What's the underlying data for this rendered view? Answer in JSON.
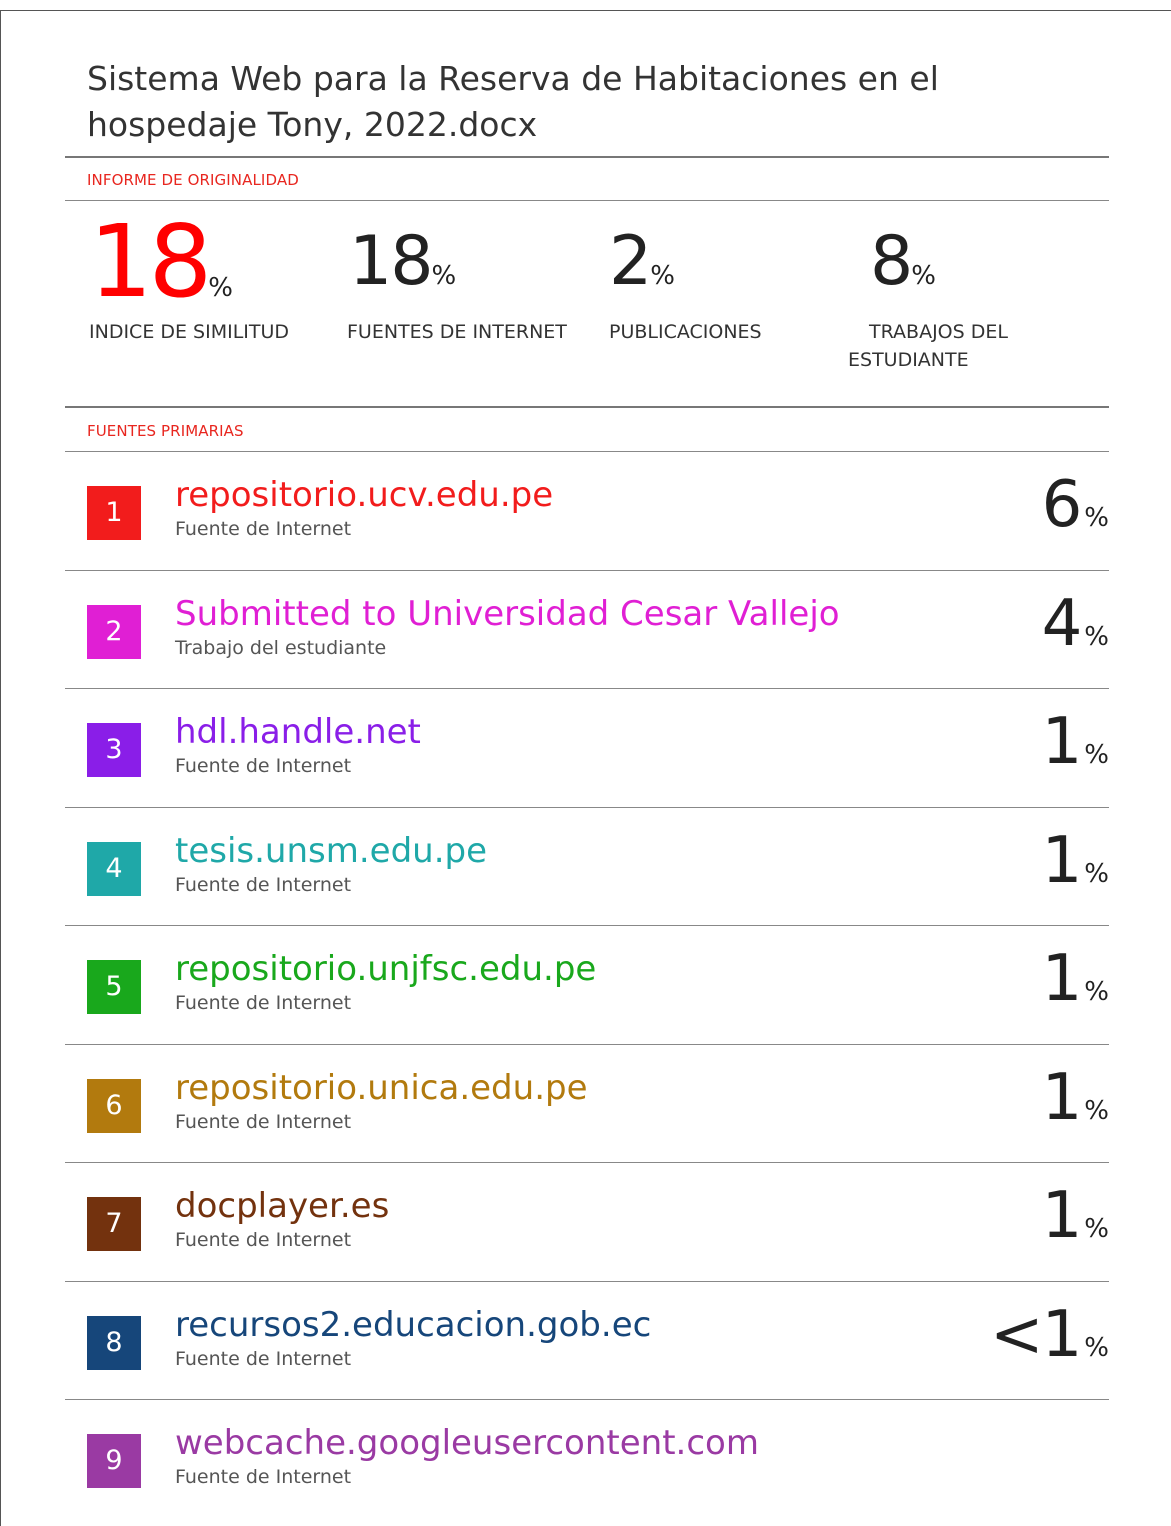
{
  "document": {
    "title": "Sistema Web para la Reserva de Habitaciones en el hospedaje Tony, 2022.docx"
  },
  "report": {
    "section_label": "INFORME DE ORIGINALIDAD",
    "stats": [
      {
        "value": "18",
        "unit": "%",
        "label": "INDICE DE SIMILITUD"
      },
      {
        "value": "18",
        "unit": "%",
        "label": "FUENTES DE INTERNET"
      },
      {
        "value": "2",
        "unit": "%",
        "label": "PUBLICACIONES"
      },
      {
        "value": "8",
        "unit": "%",
        "label_line1": "TRABAJOS DEL",
        "label_line2": "ESTUDIANTE"
      }
    ]
  },
  "sources": {
    "section_label": "FUENTES PRIMARIAS",
    "items": [
      {
        "rank": "1",
        "name": "repositorio.ucv.edu.pe",
        "type": "Fuente de Internet",
        "percent": "6",
        "unit": "%",
        "color": "#f21c1c"
      },
      {
        "rank": "2",
        "name": "Submitted to Universidad Cesar Vallejo",
        "type": "Trabajo del estudiante",
        "percent": "4",
        "unit": "%",
        "color": "#e01fd4"
      },
      {
        "rank": "3",
        "name": "hdl.handle.net",
        "type": "Fuente de Internet",
        "percent": "1",
        "unit": "%",
        "color": "#8a1ee8"
      },
      {
        "rank": "4",
        "name": "tesis.unsm.edu.pe",
        "type": "Fuente de Internet",
        "percent": "1",
        "unit": "%",
        "color": "#1fa8a8"
      },
      {
        "rank": "5",
        "name": "repositorio.unjfsc.edu.pe",
        "type": "Fuente de Internet",
        "percent": "1",
        "unit": "%",
        "color": "#19a81c"
      },
      {
        "rank": "6",
        "name": "repositorio.unica.edu.pe",
        "type": "Fuente de Internet",
        "percent": "1",
        "unit": "%",
        "color": "#b27a0e"
      },
      {
        "rank": "7",
        "name": "docplayer.es",
        "type": "Fuente de Internet",
        "percent": "1",
        "unit": "%",
        "color": "#73320e"
      },
      {
        "rank": "8",
        "name": "recursos2.educacion.gob.ec",
        "type": "Fuente de Internet",
        "percent": "<1",
        "unit": "%",
        "color": "#16467a"
      },
      {
        "rank": "9",
        "name": "webcache.googleusercontent.com",
        "type": "Fuente de Internet",
        "percent": "",
        "unit": "",
        "color": "#9a3aa3"
      }
    ]
  },
  "colors": {
    "accent_red": "#ff0000",
    "section_label": "#e8261f"
  }
}
